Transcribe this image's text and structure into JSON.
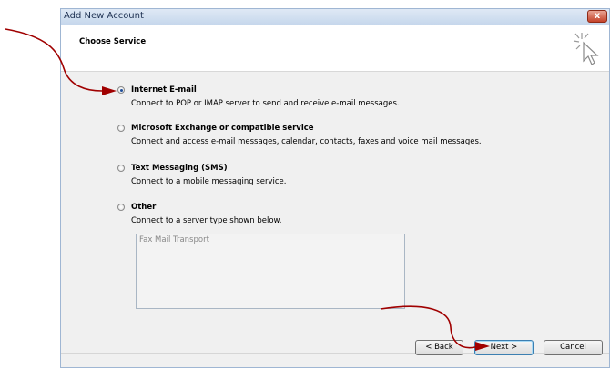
{
  "window": {
    "title": "Add New Account",
    "close_glyph": "x"
  },
  "header": {
    "title": "Choose Service",
    "icon": "cursor-sparkle-icon"
  },
  "options": [
    {
      "label": "Internet E-mail",
      "description": "Connect to POP or IMAP server to send and receive e-mail messages.",
      "selected": true
    },
    {
      "label": "Microsoft Exchange or compatible service",
      "description": "Connect and access e-mail messages, calendar, contacts, faxes and voice mail messages.",
      "selected": false
    },
    {
      "label": "Text Messaging (SMS)",
      "description": "Connect to a mobile messaging service.",
      "selected": false
    },
    {
      "label": "Other",
      "description": "Connect to a server type shown below.",
      "selected": false
    }
  ],
  "other_list": {
    "items": [
      "Fax Mail Transport"
    ]
  },
  "buttons": {
    "back": "< Back",
    "next": "Next >",
    "cancel": "Cancel"
  },
  "colors": {
    "annotation_arrow": "#a00000",
    "title_bar": "#c6d7ec",
    "close_button": "#c4432a"
  }
}
